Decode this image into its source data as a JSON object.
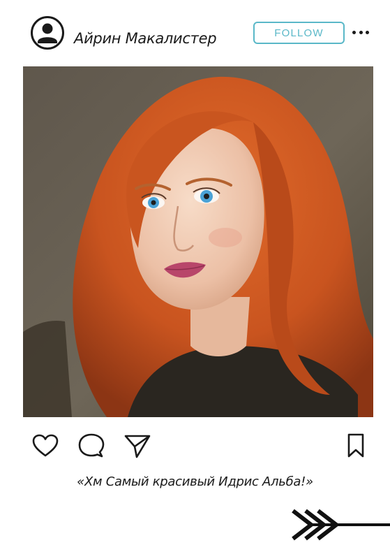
{
  "post": {
    "author": {
      "name": "Айрин Макалистер",
      "avatar_icon": "user-avatar-icon"
    },
    "follow_label": "FOLLOW",
    "follow_color": "#5ab8c8",
    "more_icon": "more-dots-icon",
    "photo": {
      "subject": "portrait of a red-haired woman with blue eyes in a dark top"
    },
    "actions": [
      {
        "icon": "heart-icon"
      },
      {
        "icon": "comment-icon"
      },
      {
        "icon": "share-icon"
      },
      {
        "icon": "bookmark-icon"
      }
    ],
    "caption": "«Хм Самый красивый Идрис Альба!»",
    "decoration_icon": "arrow-icon"
  }
}
